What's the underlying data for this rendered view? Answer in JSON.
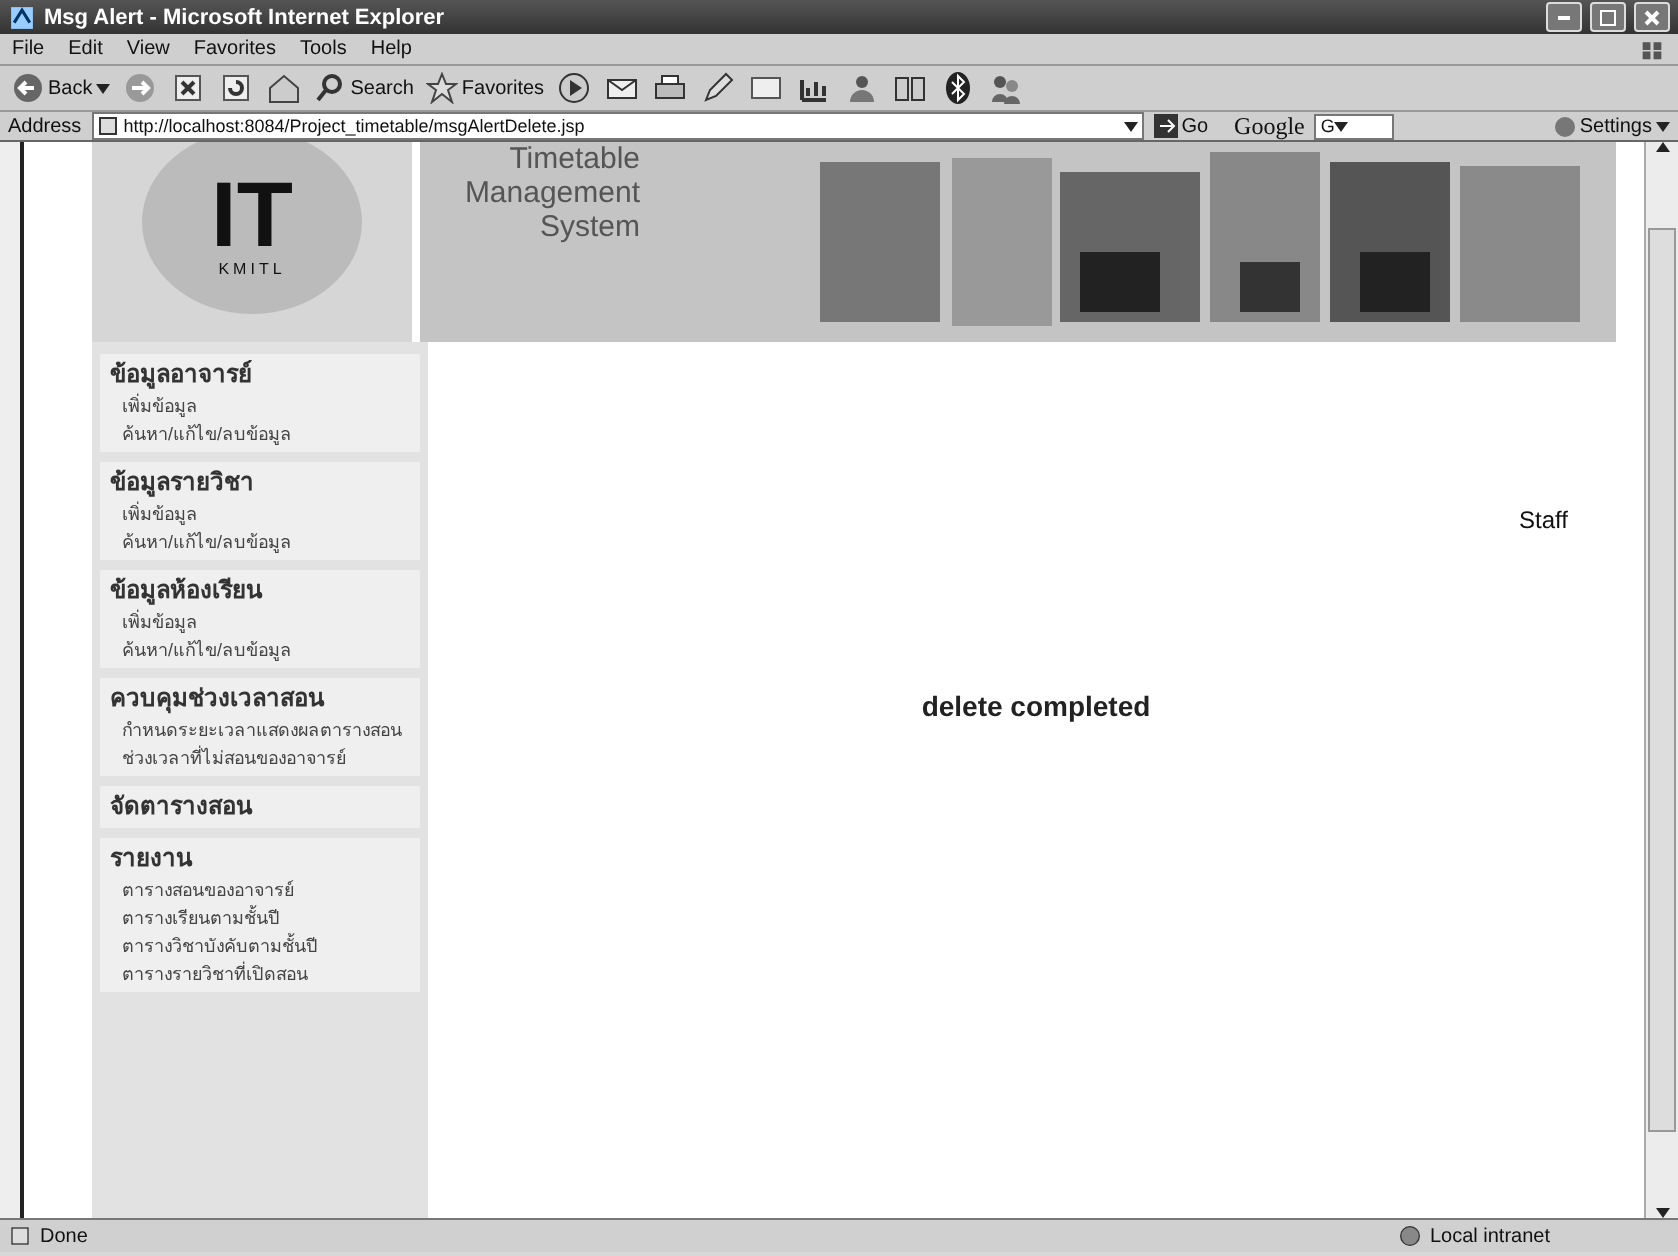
{
  "window": {
    "title": "Msg Alert - Microsoft Internet Explorer"
  },
  "menu": [
    "File",
    "Edit",
    "View",
    "Favorites",
    "Tools",
    "Help"
  ],
  "toolbar": {
    "back": "Back",
    "search": "Search",
    "favorites": "Favorites"
  },
  "address_bar": {
    "label": "Address",
    "url": "http://localhost:8084/Project_timetable/msgAlertDelete.jsp",
    "go": "Go",
    "google": "Google",
    "google_field": "G",
    "settings": "Settings"
  },
  "logo": {
    "mark": "IT",
    "caption": "KMITL"
  },
  "banner": {
    "lines": [
      "Timetable",
      "Management",
      "System"
    ]
  },
  "sidebar": [
    {
      "heading": "ข้อมูลอาจารย์",
      "items": [
        "เพิ่มข้อมูล",
        "ค้นหา/แก้ไข/ลบข้อมูล"
      ]
    },
    {
      "heading": "ข้อมูลรายวิชา",
      "items": [
        "เพิ่มข้อมูล",
        "ค้นหา/แก้ไข/ลบข้อมูล"
      ]
    },
    {
      "heading": "ข้อมูลห้องเรียน",
      "items": [
        "เพิ่มข้อมูล",
        "ค้นหา/แก้ไข/ลบข้อมูล"
      ]
    },
    {
      "heading": "ควบคุมช่วงเวลาสอน",
      "items": [
        "กำหนดระยะเวลาแสดงผลตารางสอน",
        "ช่วงเวลาที่ไม่สอนของอาจารย์"
      ]
    },
    {
      "heading": "จัดตารางสอน"
    },
    {
      "heading": "รายงาน",
      "items": [
        "ตารางสอนของอาจารย์",
        "ตารางเรียนตามชั้นปี",
        "ตารางวิชาบังคับตามชั้นปี",
        "ตารางรายวิชาที่เปิดสอน"
      ]
    }
  ],
  "user": "Staff",
  "message": "delete completed",
  "status_bar": {
    "text": "Done",
    "zone": "Local intranet"
  }
}
